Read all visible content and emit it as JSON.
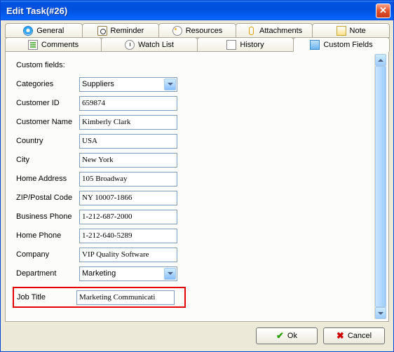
{
  "window": {
    "title": "Edit Task(#26)"
  },
  "tabs_row1": [
    {
      "name": "general",
      "label": "General",
      "iconClass": "ico-general"
    },
    {
      "name": "reminder",
      "label": "Reminder",
      "iconClass": "ico-reminder"
    },
    {
      "name": "resources",
      "label": "Resources",
      "iconClass": "ico-resources"
    },
    {
      "name": "attachments",
      "label": "Attachments",
      "iconClass": "ico-attach"
    },
    {
      "name": "note",
      "label": "Note",
      "iconClass": "ico-note"
    }
  ],
  "tabs_row2": [
    {
      "name": "comments",
      "label": "Comments",
      "iconClass": "ico-comments"
    },
    {
      "name": "watchlist",
      "label": "Watch List",
      "iconClass": "ico-watch"
    },
    {
      "name": "history",
      "label": "History",
      "iconClass": "ico-history"
    },
    {
      "name": "customfields",
      "label": "Custom Fields",
      "iconClass": "ico-custom",
      "active": true
    }
  ],
  "section_label": "Custom fields:",
  "fields": {
    "categories": {
      "label": "Categories",
      "value": "Suppliers",
      "type": "select"
    },
    "customer_id": {
      "label": "Customer ID",
      "value": "659874"
    },
    "customer_name": {
      "label": "Customer Name",
      "value": "Kimberly Clark"
    },
    "country": {
      "label": "Country",
      "value": "USA"
    },
    "city": {
      "label": "City",
      "value": "New York"
    },
    "home_address": {
      "label": "Home Address",
      "value": "105 Broadway"
    },
    "zip": {
      "label": "ZIP/Postal Code",
      "value": "NY 10007-1866"
    },
    "business_phone": {
      "label": "Business Phone",
      "value": "1-212-687-2000"
    },
    "home_phone": {
      "label": "Home Phone",
      "value": "1-212-640-5289"
    },
    "company": {
      "label": "Company",
      "value": "VIP Quality Software"
    },
    "department": {
      "label": "Department",
      "value": "Marketing",
      "type": "select"
    },
    "job_title": {
      "label": "Job Title",
      "value": "Marketing Communicati"
    }
  },
  "buttons": {
    "ok": "Ok",
    "cancel": "Cancel"
  }
}
